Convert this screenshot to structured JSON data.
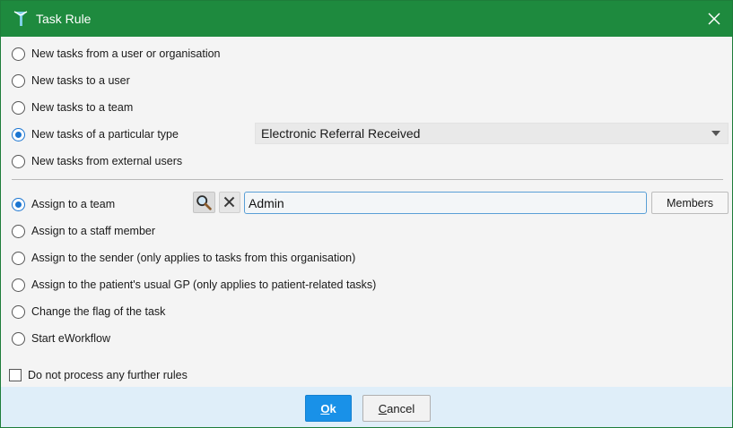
{
  "window": {
    "title": "Task Rule"
  },
  "icons": {
    "app": "task-rule-icon",
    "close": "close-icon",
    "dropdown": "chevron-down-icon",
    "search": "search-icon",
    "clear": "clear-x-icon"
  },
  "colors": {
    "titlebar": "#1e8a3e",
    "accent": "#1a75d1",
    "ok_button": "#1991e8",
    "footer": "#dfeef9"
  },
  "source_options": [
    {
      "label": "New tasks from a user or organisation",
      "checked": false
    },
    {
      "label": "New tasks to a user",
      "checked": false
    },
    {
      "label": "New tasks to a team",
      "checked": false
    },
    {
      "label": "New tasks of a particular type",
      "checked": true
    },
    {
      "label": "New tasks from external users",
      "checked": false
    }
  ],
  "task_type_select": {
    "value": "Electronic Referral Received"
  },
  "action_options": [
    {
      "label": "Assign to a team",
      "checked": true
    },
    {
      "label": "Assign to a staff member",
      "checked": false
    },
    {
      "label": "Assign to the sender (only applies to tasks from this organisation)",
      "checked": false
    },
    {
      "label": "Assign to the patient's usual GP (only applies to patient-related tasks)",
      "checked": false
    },
    {
      "label": "Change the flag of the task",
      "checked": false
    },
    {
      "label": "Start eWorkflow",
      "checked": false
    }
  ],
  "team_field": {
    "value": "Admin",
    "members_label": "Members"
  },
  "no_further_rules": {
    "label": "Do not process any further rules",
    "checked": false
  },
  "buttons": {
    "ok_mnemonic": "O",
    "ok_rest": "k",
    "cancel_mnemonic": "C",
    "cancel_rest": "ancel"
  }
}
